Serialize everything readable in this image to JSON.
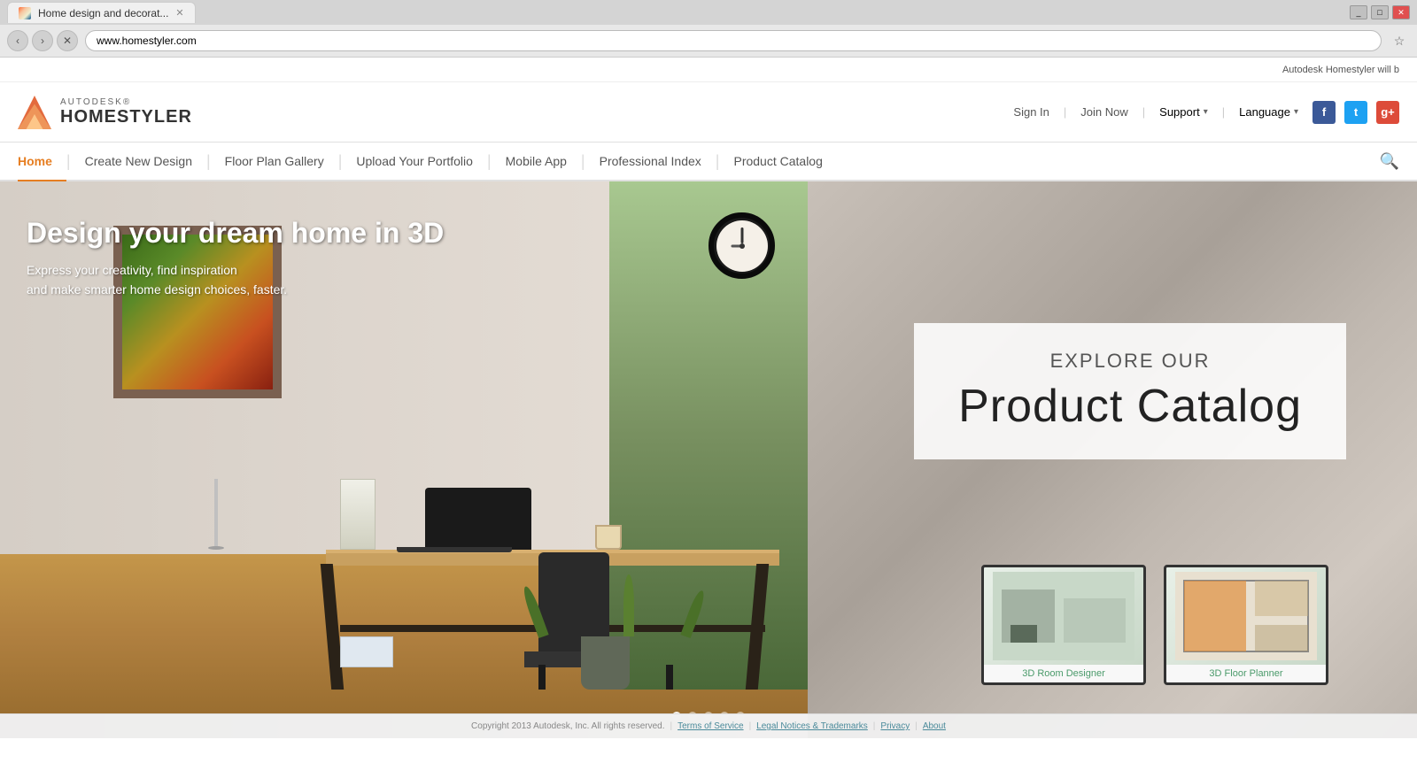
{
  "browser": {
    "tab_title": "Home design and decorat...",
    "url": "www.homestyler.com",
    "close_char": "✕",
    "back_char": "‹",
    "forward_char": "›",
    "refresh_char": "✕",
    "star_char": "☆"
  },
  "top_bar": {
    "message": "Autodesk Homestyler will b"
  },
  "header": {
    "logo_autodesk": "AUTODESK®",
    "logo_homestyler": "HOMESTYLER",
    "sign_in": "Sign In",
    "join_now": "Join Now",
    "support": "Support",
    "language": "Language",
    "facebook_char": "f",
    "twitter_char": "t",
    "gplus_char": "g+"
  },
  "nav": {
    "items": [
      {
        "label": "Home",
        "active": true
      },
      {
        "label": "Create New Design",
        "active": false
      },
      {
        "label": "Floor Plan Gallery",
        "active": false
      },
      {
        "label": "Upload Your Portfolio",
        "active": false
      },
      {
        "label": "Mobile App",
        "active": false
      },
      {
        "label": "Professional Index",
        "active": false
      },
      {
        "label": "Product Catalog",
        "active": false
      }
    ],
    "search_char": "🔍"
  },
  "hero": {
    "headline": "Design your dream home in 3D",
    "subline1": "Express your creativity, find inspiration",
    "subline2": "and make smarter home design choices, faster.",
    "catalog_explore": "EXPLORE OUR",
    "catalog_title": "Product Catalog"
  },
  "thumbnails": [
    {
      "label": "3D Room Designer"
    },
    {
      "label": "3D Floor Planner"
    }
  ],
  "dots": [
    {
      "active": true
    },
    {
      "active": false
    },
    {
      "active": false
    },
    {
      "active": false
    },
    {
      "active": false
    }
  ],
  "footer": {
    "copyright": "Copyright 2013 Autodesk, Inc. All rights reserved.",
    "terms": "Terms of Service",
    "legal": "Legal Notices & Trademarks",
    "privacy": "Privacy",
    "about": "About"
  }
}
